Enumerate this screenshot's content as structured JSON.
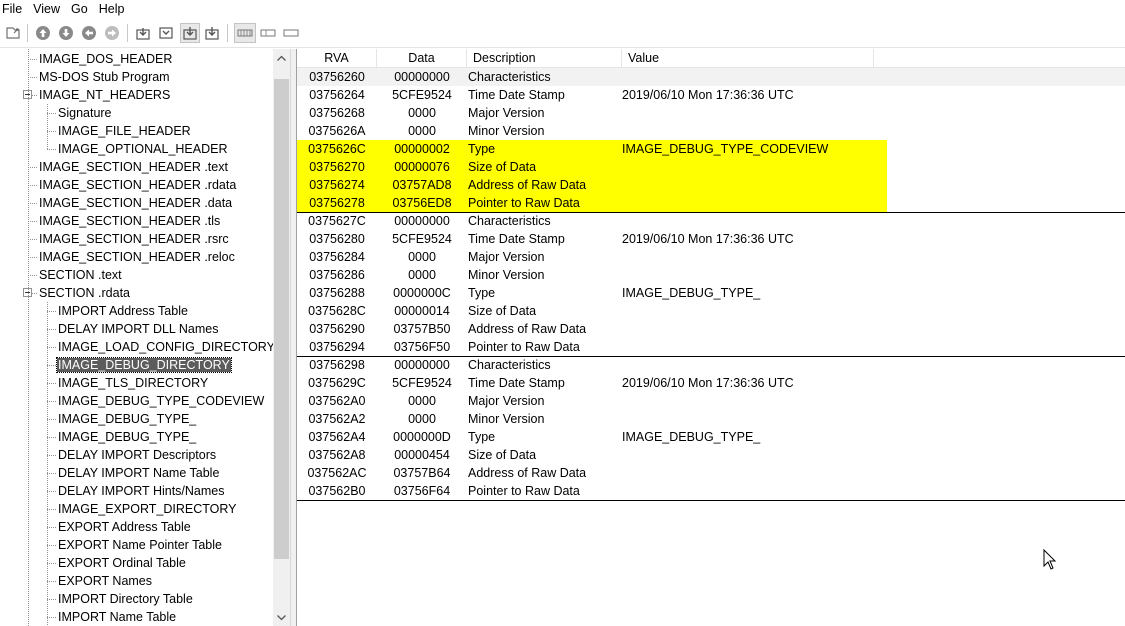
{
  "menu": [
    "File",
    "View",
    "Go",
    "Help"
  ],
  "toolbar": {
    "buttons": [
      "open-icon",
      "nav-up-icon",
      "nav-down-icon",
      "nav-back-icon",
      "nav-forward-icon",
      "goto-start-icon",
      "goto-end-icon",
      "goto-prev-icon",
      "goto-next-icon",
      "view-table-icon",
      "view-hex-icon",
      "view-text-icon"
    ]
  },
  "tree": {
    "items": [
      {
        "label": "IMAGE_DOS_HEADER",
        "level": 1
      },
      {
        "label": "MS-DOS Stub Program",
        "level": 1
      },
      {
        "label": "IMAGE_NT_HEADERS",
        "level": 1,
        "expanded": true
      },
      {
        "label": "Signature",
        "level": 2
      },
      {
        "label": "IMAGE_FILE_HEADER",
        "level": 2
      },
      {
        "label": "IMAGE_OPTIONAL_HEADER",
        "level": 2
      },
      {
        "label": "IMAGE_SECTION_HEADER .text",
        "level": 1
      },
      {
        "label": "IMAGE_SECTION_HEADER .rdata",
        "level": 1
      },
      {
        "label": "IMAGE_SECTION_HEADER .data",
        "level": 1
      },
      {
        "label": "IMAGE_SECTION_HEADER .tls",
        "level": 1
      },
      {
        "label": "IMAGE_SECTION_HEADER .rsrc",
        "level": 1
      },
      {
        "label": "IMAGE_SECTION_HEADER .reloc",
        "level": 1
      },
      {
        "label": "SECTION .text",
        "level": 1
      },
      {
        "label": "SECTION .rdata",
        "level": 1,
        "expanded": true
      },
      {
        "label": "IMPORT Address Table",
        "level": 2
      },
      {
        "label": "DELAY IMPORT DLL Names",
        "level": 2
      },
      {
        "label": "IMAGE_LOAD_CONFIG_DIRECTORY",
        "level": 2
      },
      {
        "label": "IMAGE_DEBUG_DIRECTORY",
        "level": 2,
        "selected": true
      },
      {
        "label": "IMAGE_TLS_DIRECTORY",
        "level": 2
      },
      {
        "label": "IMAGE_DEBUG_TYPE_CODEVIEW",
        "level": 2
      },
      {
        "label": "IMAGE_DEBUG_TYPE_",
        "level": 2
      },
      {
        "label": "IMAGE_DEBUG_TYPE_",
        "level": 2
      },
      {
        "label": "DELAY IMPORT Descriptors",
        "level": 2
      },
      {
        "label": "DELAY IMPORT Name Table",
        "level": 2
      },
      {
        "label": "DELAY IMPORT Hints/Names",
        "level": 2
      },
      {
        "label": "IMAGE_EXPORT_DIRECTORY",
        "level": 2
      },
      {
        "label": "EXPORT Address Table",
        "level": 2
      },
      {
        "label": "EXPORT Name Pointer Table",
        "level": 2
      },
      {
        "label": "EXPORT Ordinal Table",
        "level": 2
      },
      {
        "label": "EXPORT Names",
        "level": 2
      },
      {
        "label": "IMPORT Directory Table",
        "level": 2
      },
      {
        "label": "IMPORT Name Table",
        "level": 2
      }
    ]
  },
  "table": {
    "columns": [
      "RVA",
      "Data",
      "Description",
      "Value"
    ],
    "highlight_color": "#ffff00",
    "rows": [
      {
        "rva": "03756260",
        "data": "00000000",
        "desc": "Characteristics",
        "value": ""
      },
      {
        "rva": "03756264",
        "data": "5CFE9524",
        "desc": "Time Date Stamp",
        "value": "2019/06/10 Mon 17:36:36 UTC"
      },
      {
        "rva": "03756268",
        "data": "0000",
        "desc": "Major Version",
        "value": ""
      },
      {
        "rva": "0375626A",
        "data": "0000",
        "desc": "Minor Version",
        "value": ""
      },
      {
        "rva": "0375626C",
        "data": "00000002",
        "desc": "Type",
        "value": "IMAGE_DEBUG_TYPE_CODEVIEW",
        "highlight": true
      },
      {
        "rva": "03756270",
        "data": "00000076",
        "desc": "Size of Data",
        "value": "",
        "highlight": true
      },
      {
        "rva": "03756274",
        "data": "03757AD8",
        "desc": "Address of Raw Data",
        "value": "",
        "highlight": true
      },
      {
        "rva": "03756278",
        "data": "03756ED8",
        "desc": "Pointer to Raw Data",
        "value": "",
        "highlight": true,
        "group_end": true
      },
      {
        "rva": "0375627C",
        "data": "00000000",
        "desc": "Characteristics",
        "value": ""
      },
      {
        "rva": "03756280",
        "data": "5CFE9524",
        "desc": "Time Date Stamp",
        "value": "2019/06/10 Mon 17:36:36 UTC"
      },
      {
        "rva": "03756284",
        "data": "0000",
        "desc": "Major Version",
        "value": ""
      },
      {
        "rva": "03756286",
        "data": "0000",
        "desc": "Minor Version",
        "value": ""
      },
      {
        "rva": "03756288",
        "data": "0000000C",
        "desc": "Type",
        "value": "IMAGE_DEBUG_TYPE_"
      },
      {
        "rva": "0375628C",
        "data": "00000014",
        "desc": "Size of Data",
        "value": ""
      },
      {
        "rva": "03756290",
        "data": "03757B50",
        "desc": "Address of Raw Data",
        "value": ""
      },
      {
        "rva": "03756294",
        "data": "03756F50",
        "desc": "Pointer to Raw Data",
        "value": "",
        "group_end": true
      },
      {
        "rva": "03756298",
        "data": "00000000",
        "desc": "Characteristics",
        "value": ""
      },
      {
        "rva": "0375629C",
        "data": "5CFE9524",
        "desc": "Time Date Stamp",
        "value": "2019/06/10 Mon 17:36:36 UTC"
      },
      {
        "rva": "037562A0",
        "data": "0000",
        "desc": "Major Version",
        "value": ""
      },
      {
        "rva": "037562A2",
        "data": "0000",
        "desc": "Minor Version",
        "value": ""
      },
      {
        "rva": "037562A4",
        "data": "0000000D",
        "desc": "Type",
        "value": "IMAGE_DEBUG_TYPE_"
      },
      {
        "rva": "037562A8",
        "data": "00000454",
        "desc": "Size of Data",
        "value": ""
      },
      {
        "rva": "037562AC",
        "data": "03757B64",
        "desc": "Address of Raw Data",
        "value": ""
      },
      {
        "rva": "037562B0",
        "data": "03756F64",
        "desc": "Pointer to Raw Data",
        "value": "",
        "group_end": true
      }
    ]
  }
}
